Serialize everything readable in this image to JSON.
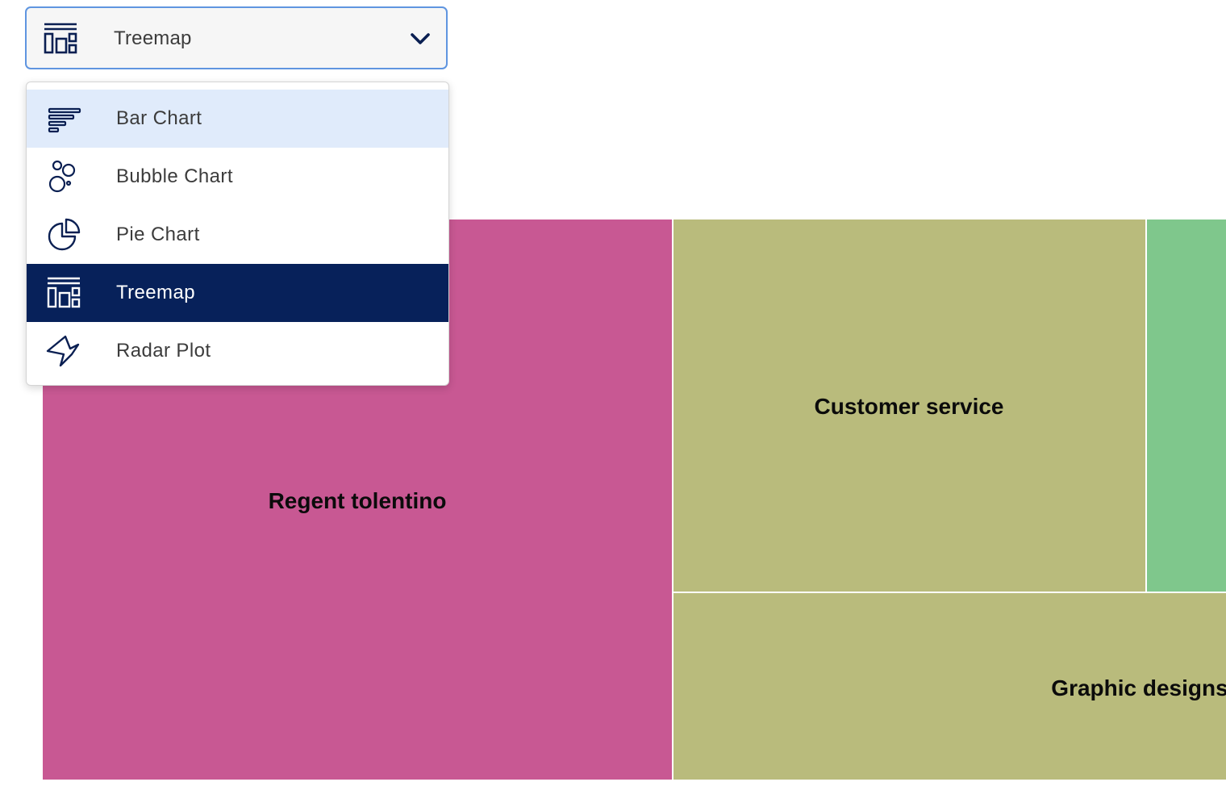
{
  "select": {
    "value": "Treemap",
    "icon": "treemap-icon"
  },
  "menu": {
    "items": [
      {
        "label": "Bar Chart",
        "icon": "bar-chart-icon",
        "state": "hover"
      },
      {
        "label": "Bubble Chart",
        "icon": "bubble-chart-icon",
        "state": "normal"
      },
      {
        "label": "Pie Chart",
        "icon": "pie-chart-icon",
        "state": "normal"
      },
      {
        "label": "Treemap",
        "icon": "treemap-icon",
        "state": "selected"
      },
      {
        "label": "Radar Plot",
        "icon": "radar-plot-icon",
        "state": "normal"
      }
    ]
  },
  "colors": {
    "accent_border": "#5f95e0",
    "selected_bg": "#07215a",
    "hover_bg": "#e0ebfb",
    "icon": "#0a1f52"
  },
  "chart_data": {
    "type": "treemap",
    "tiles": [
      {
        "label": "Regent tolentino",
        "color": "#c85893"
      },
      {
        "label": "Customer service",
        "color": "#b9bb7c"
      },
      {
        "label": "",
        "color": "#7fc78c"
      },
      {
        "label": "Graphic designs",
        "color": "#b9bb7c"
      }
    ]
  }
}
